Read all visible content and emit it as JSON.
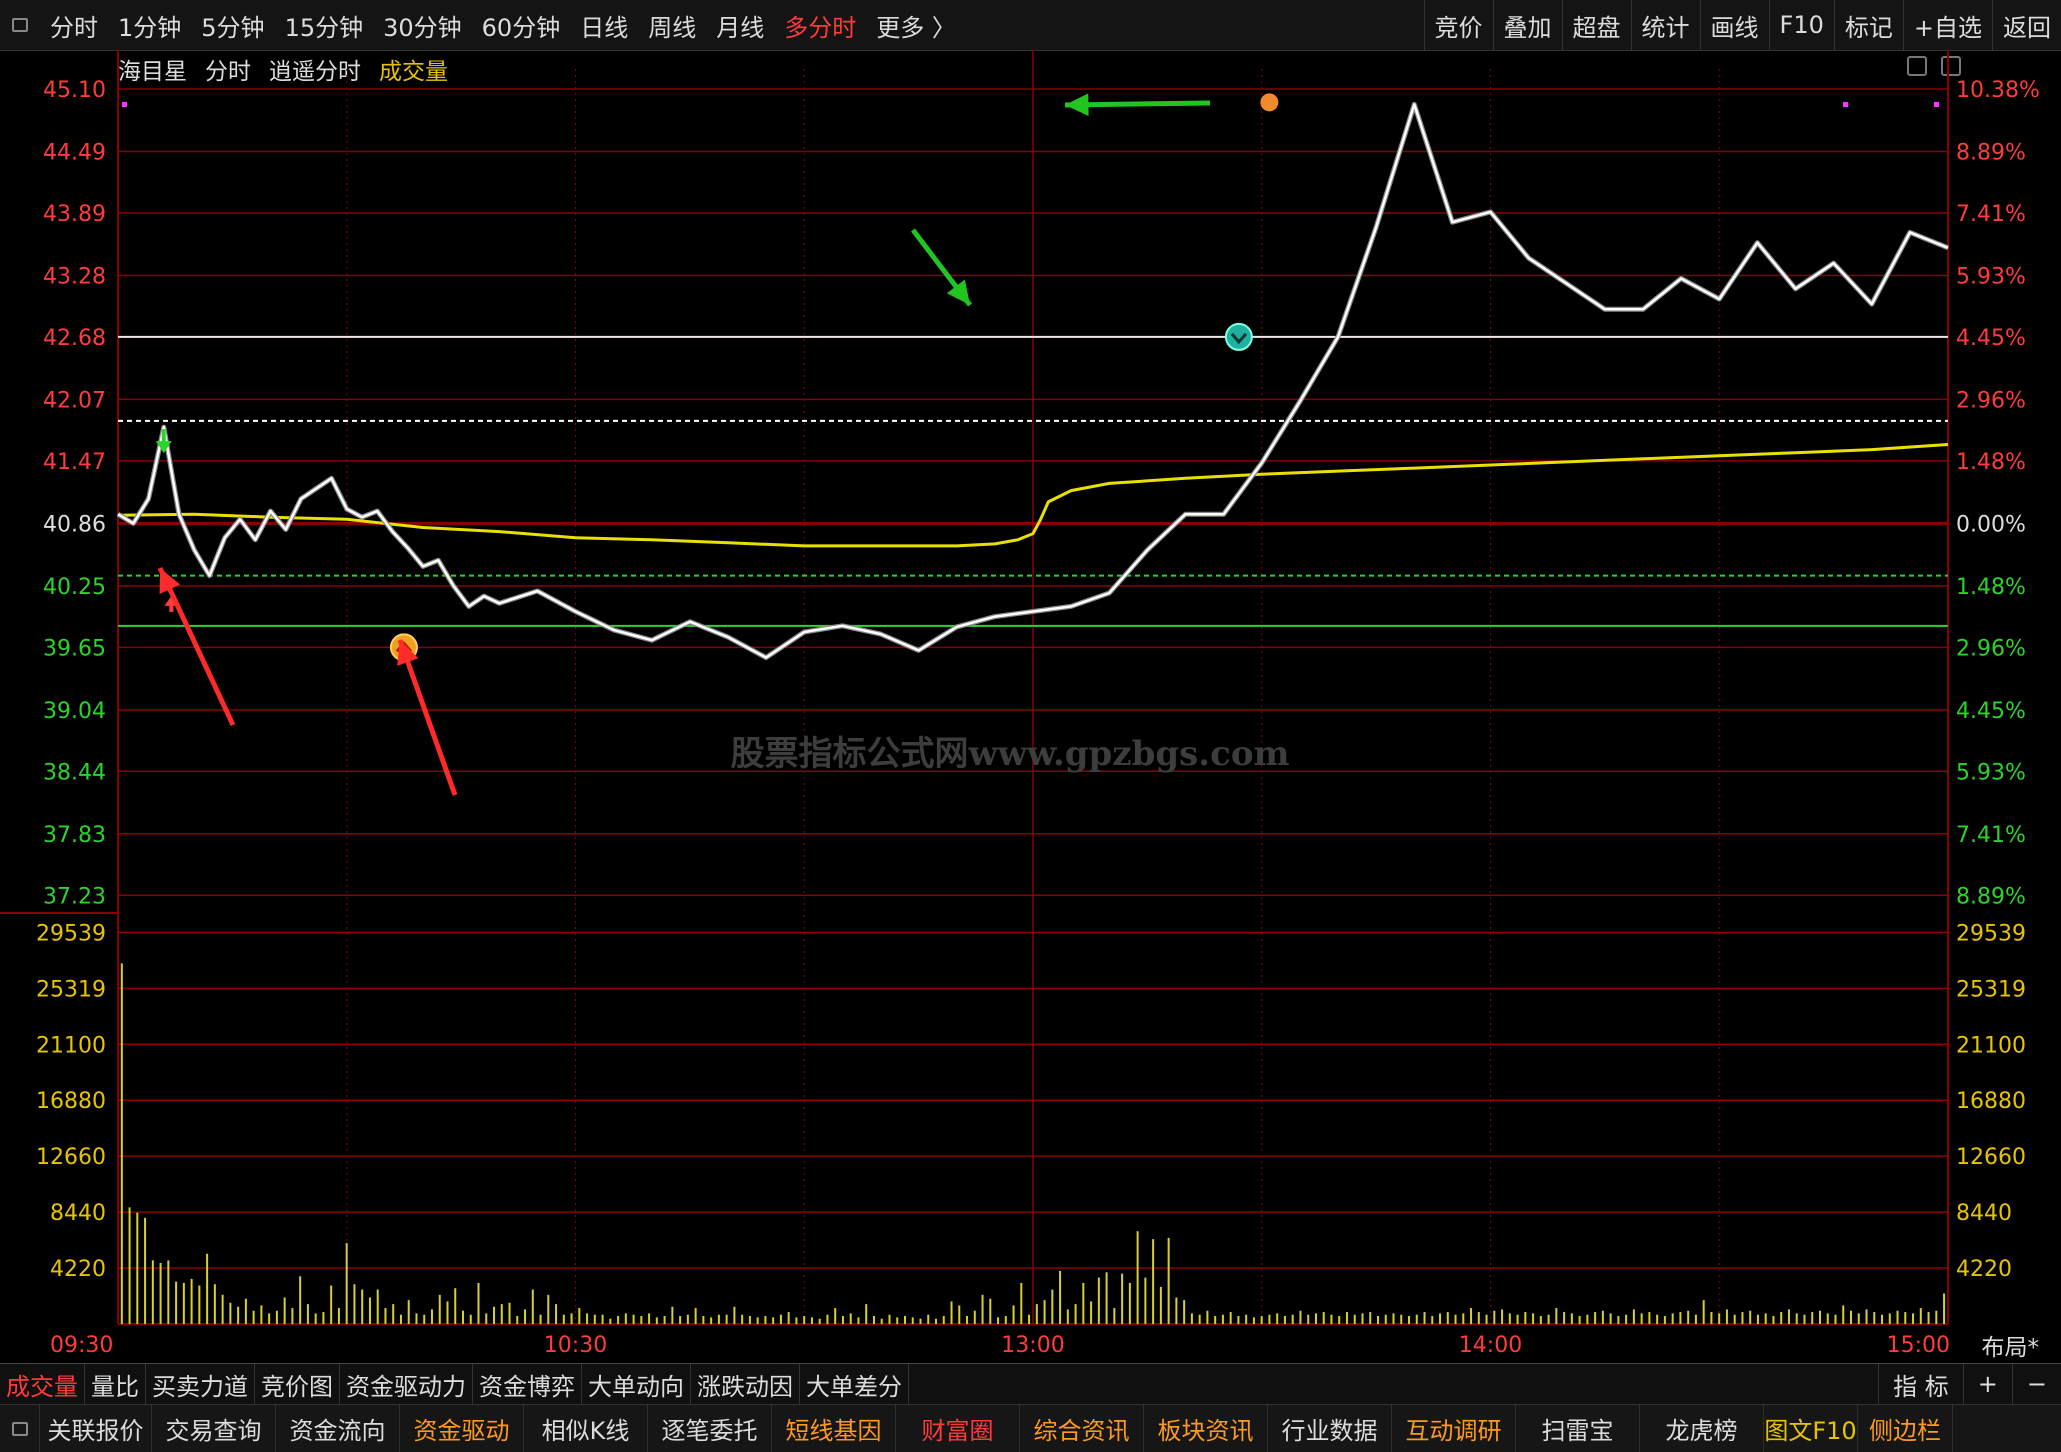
{
  "topbar": {
    "left_items": [
      "分时",
      "1分钟",
      "5分钟",
      "15分钟",
      "30分钟",
      "60分钟",
      "日线",
      "周线",
      "月线",
      "多分时",
      "更多 〉"
    ],
    "active_item": "多分时",
    "right_items": [
      "竞价",
      "叠加",
      "超盘",
      "统计",
      "画线",
      "F10",
      "标记",
      "+自选",
      "返回"
    ]
  },
  "chart_head": {
    "stock_name": "海目星",
    "mode": "分时",
    "style": "逍遥分时",
    "indicator": "成交量"
  },
  "watermark": "股票指标公式网www.gpzbgs.com",
  "layout_label": "布局*",
  "colors": {
    "up": "#ff3b3b",
    "down": "#2bd42b",
    "price_line": "#ffffff",
    "avg_line": "#e8e000",
    "grid": "#8a0000",
    "volume": "#d8d030"
  },
  "chart_data": [
    {
      "type": "line",
      "title": "",
      "prev_close": 40.86,
      "ylim": [
        36.93,
        45.1
      ],
      "y_ticks_left": [
        "45.10",
        "44.49",
        "43.89",
        "43.28",
        "42.68",
        "42.07",
        "41.47",
        "40.86",
        "40.25",
        "39.65",
        "39.04",
        "38.44",
        "37.83",
        "37.23"
      ],
      "y_ticks_right": [
        "10.38%",
        "8.89%",
        "7.41%",
        "5.93%",
        "4.45%",
        "2.96%",
        "1.48%",
        "0.00%",
        "1.48%",
        "2.96%",
        "4.45%",
        "5.93%",
        "7.41%",
        "8.89%"
      ],
      "x_ticks": [
        "09:30",
        "10:30",
        "13:00",
        "14:00",
        "15:00"
      ],
      "reference_lines": {
        "white": 42.68,
        "white_dashed": 41.86,
        "green_dashed": 40.35,
        "green": 39.86
      },
      "series": [
        {
          "x": [
            0,
            2,
            4,
            6,
            8,
            10,
            12,
            14,
            16,
            18,
            20,
            22,
            24,
            26,
            28,
            30,
            32,
            34,
            36,
            38,
            40,
            42,
            44,
            46,
            48,
            50,
            55,
            60,
            65,
            70,
            75,
            80,
            85,
            90,
            95,
            100,
            105,
            110,
            115,
            120,
            125,
            130,
            135,
            140,
            145,
            150,
            155,
            160,
            165,
            170,
            175,
            180,
            185,
            190,
            195,
            200,
            205,
            210,
            215,
            220,
            225,
            230,
            235,
            240
          ],
          "y": [
            40.95,
            40.86,
            41.1,
            41.8,
            40.95,
            40.6,
            40.35,
            40.72,
            40.9,
            40.7,
            40.98,
            40.8,
            41.1,
            41.2,
            41.3,
            41.0,
            40.92,
            40.98,
            40.78,
            40.62,
            40.44,
            40.5,
            40.25,
            40.05,
            40.15,
            40.08,
            40.2,
            40.0,
            39.82,
            39.72,
            39.9,
            39.75,
            39.55,
            39.8,
            39.86,
            39.78,
            39.62,
            39.85,
            39.95,
            40.0,
            40.05,
            40.18,
            40.6,
            40.95,
            40.95,
            41.45,
            42.05,
            42.68,
            43.75,
            44.95,
            43.8,
            43.9,
            43.45,
            43.2,
            42.95,
            42.95,
            43.25,
            43.05,
            43.6,
            43.15,
            43.4,
            43.0,
            43.7,
            43.55
          ]
        },
        {
          "x": [
            0,
            10,
            20,
            30,
            40,
            50,
            60,
            70,
            80,
            90,
            100,
            110,
            115,
            118,
            120,
            121,
            122,
            125,
            130,
            140,
            150,
            160,
            170,
            180,
            190,
            200,
            210,
            220,
            230,
            240
          ],
          "y": [
            40.94,
            40.95,
            40.92,
            40.9,
            40.82,
            40.78,
            40.72,
            40.7,
            40.67,
            40.64,
            40.64,
            40.64,
            40.66,
            40.7,
            40.76,
            40.9,
            41.07,
            41.18,
            41.25,
            41.3,
            41.34,
            41.37,
            41.4,
            41.43,
            41.46,
            41.49,
            41.52,
            41.55,
            41.58,
            41.63
          ]
        }
      ],
      "annotations": [
        "buy-signal-1",
        "buy-signal-2",
        "sell-signal-1",
        "top-marker"
      ]
    },
    {
      "type": "bar",
      "title": "成交量",
      "ylim": [
        0,
        31000
      ],
      "y_ticks": [
        "29539",
        "25319",
        "21100",
        "16880",
        "12660",
        "8440",
        "4220"
      ],
      "values": [
        27200,
        8800,
        8400,
        8000,
        4800,
        4600,
        4800,
        3200,
        3100,
        3400,
        2900,
        5300,
        3000,
        2200,
        1600,
        1300,
        1900,
        1000,
        1400,
        800,
        1000,
        2000,
        1200,
        3600,
        1500,
        800,
        900,
        2900,
        1200,
        6100,
        3000,
        2600,
        2000,
        2600,
        1200,
        1500,
        700,
        1800,
        800,
        700,
        1100,
        2200,
        1700,
        2700,
        1000,
        700,
        3100,
        800,
        1300,
        1500,
        1600,
        600,
        1100,
        2600,
        700,
        2200,
        1500,
        700,
        800,
        1200,
        800,
        700,
        700,
        400,
        600,
        800,
        700,
        600,
        800,
        500,
        600,
        1300,
        600,
        700,
        1200,
        600,
        500,
        700,
        700,
        1300,
        700,
        600,
        500,
        600,
        500,
        700,
        900,
        500,
        600,
        500,
        400,
        700,
        1200,
        600,
        800,
        500,
        1500,
        600,
        400,
        700,
        500,
        600,
        500,
        400,
        700,
        400,
        600,
        1700,
        1400,
        600,
        1000,
        2200,
        1900,
        500,
        600,
        1400,
        3100,
        700,
        1500,
        1800,
        2600,
        4000,
        1100,
        1500,
        3100,
        1700,
        3500,
        3900,
        1200,
        3800,
        3100,
        7000,
        3500,
        6400,
        2800,
        6500,
        2000,
        1800,
        800,
        700,
        1000,
        600,
        700,
        900,
        600,
        700,
        500,
        600,
        700,
        800,
        600,
        700,
        1000,
        700,
        800,
        900,
        700,
        600,
        900,
        700,
        800,
        900,
        600,
        700,
        800,
        700,
        600,
        700,
        900,
        600,
        800,
        900,
        700,
        800,
        1200,
        900,
        700,
        1000,
        1100,
        800,
        700,
        900,
        800,
        600,
        700,
        1200,
        900,
        800,
        600,
        700,
        900,
        1000,
        800,
        600,
        700,
        1100,
        800,
        900,
        700,
        600,
        800,
        900,
        1000,
        700,
        1800,
        900,
        800,
        1100,
        700,
        900,
        1000,
        700,
        800,
        600,
        900,
        1100,
        800,
        700,
        900,
        1000,
        800,
        700,
        1400,
        1000,
        800,
        1100,
        900,
        700,
        800,
        1000,
        900,
        800,
        1200,
        900,
        1000,
        2300
      ]
    }
  ],
  "indicator_tabs": [
    "成交量",
    "量比",
    "买卖力道",
    "竞价图",
    "资金驱动力",
    "资金博弈",
    "大单动向",
    "涨跌动因",
    "大单差分"
  ],
  "indicator_tabs_active": "成交量",
  "indicator_right": [
    "指 标",
    "+",
    "−"
  ],
  "footer_items": [
    {
      "label": "关联报价",
      "color": "normal"
    },
    {
      "label": "交易查询",
      "color": "normal"
    },
    {
      "label": "资金流向",
      "color": "normal"
    },
    {
      "label": "资金驱动",
      "color": "orange"
    },
    {
      "label": "相似K线",
      "color": "normal"
    },
    {
      "label": "逐笔委托",
      "color": "normal"
    },
    {
      "label": "短线基因",
      "color": "orange"
    },
    {
      "label": "财富圈",
      "color": "red"
    },
    {
      "label": "综合资讯",
      "color": "orange"
    },
    {
      "label": "板块资讯",
      "color": "orange"
    },
    {
      "label": "行业数据",
      "color": "normal"
    },
    {
      "label": "互动调研",
      "color": "orange"
    },
    {
      "label": "扫雷宝",
      "color": "normal"
    },
    {
      "label": "龙虎榜",
      "color": "normal"
    },
    {
      "label": "图文F10",
      "color": "yellow"
    },
    {
      "label": "侧边栏",
      "color": "orange"
    }
  ]
}
